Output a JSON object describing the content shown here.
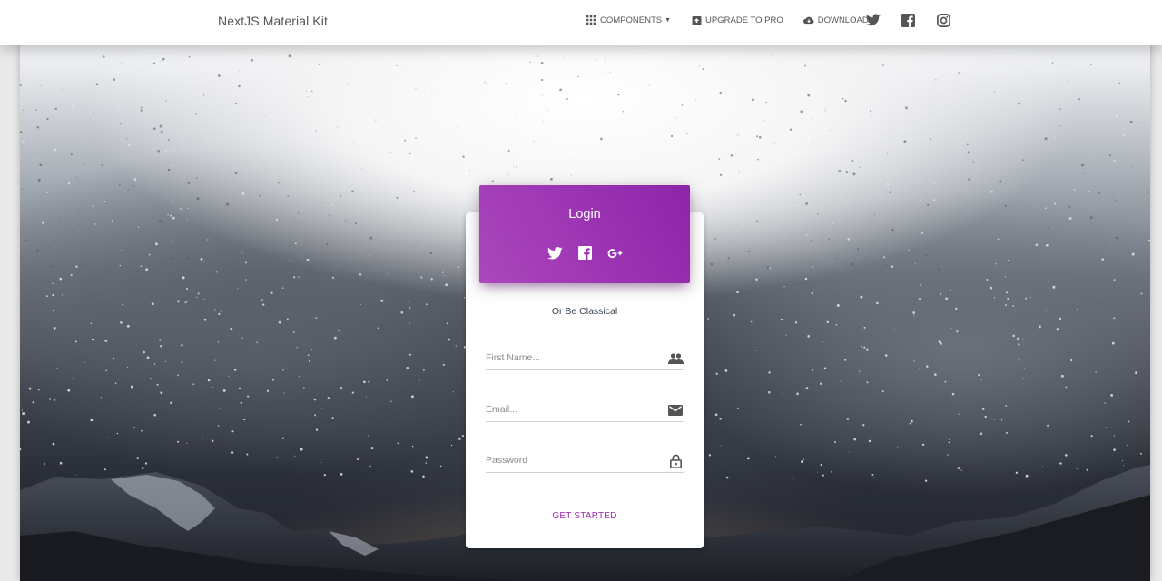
{
  "navbar": {
    "brand": "NextJS Material Kit",
    "items": [
      {
        "label": "Components",
        "icon": "apps-icon",
        "has_caret": true
      },
      {
        "label": "Upgrade to pro",
        "icon": "unarchive-icon"
      },
      {
        "label": "Download",
        "icon": "cloud-download-icon"
      }
    ],
    "social": [
      "twitter-icon",
      "facebook-icon",
      "instagram-icon"
    ]
  },
  "login": {
    "title": "Login",
    "social": [
      "twitter-icon",
      "facebook-icon",
      "google-plus-icon"
    ],
    "divider": "Or Be Classical",
    "fields": {
      "first_name": {
        "placeholder": "First Name...",
        "value": "",
        "icon": "people-icon"
      },
      "email": {
        "placeholder": "Email...",
        "value": "",
        "icon": "email-icon"
      },
      "password": {
        "placeholder": "Password",
        "value": "",
        "icon": "lock-icon"
      }
    },
    "submit": "Get started"
  },
  "colors": {
    "accent": "#9c27b0",
    "header_gradient": [
      "#ab47bc",
      "#8e24aa"
    ],
    "nav_text": "#555555"
  }
}
